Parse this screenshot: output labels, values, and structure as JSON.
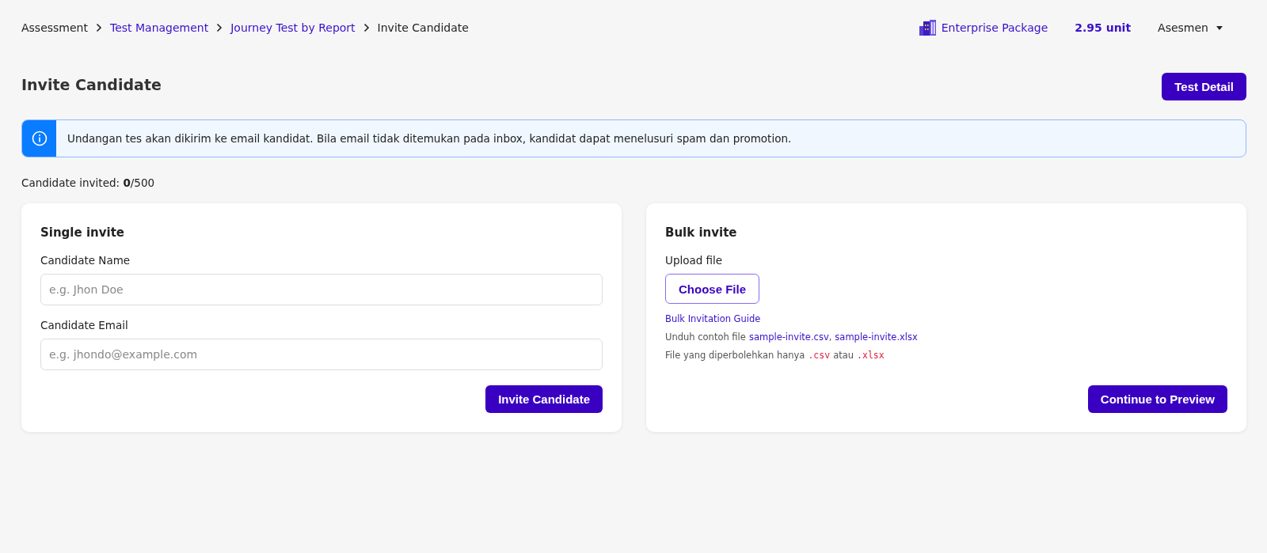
{
  "breadcrumb": [
    {
      "label": "Assessment",
      "link": false
    },
    {
      "label": "Test Management",
      "link": true
    },
    {
      "label": "Journey Test by Report",
      "link": true
    },
    {
      "label": "Invite Candidate",
      "link": false
    }
  ],
  "header": {
    "package": "Enterprise Package",
    "units": "2.95 unit",
    "user": "Asesmen"
  },
  "title": "Invite Candidate",
  "test_detail_button": "Test Detail",
  "info": "Undangan tes akan dikirim ke email kandidat. Bila email tidak ditemukan pada inbox, kandidat dapat menelusuri spam dan promotion.",
  "invited": {
    "label": "Candidate invited: ",
    "count": "0",
    "total": "/500"
  },
  "single": {
    "title": "Single invite",
    "fields": [
      {
        "label": "Candidate Name",
        "placeholder": "e.g. Jhon Doe"
      },
      {
        "label": "Candidate Email",
        "placeholder": "e.g. jhondo@example.com"
      }
    ],
    "button": "Invite Candidate"
  },
  "bulk": {
    "title": "Bulk invite",
    "upload_label": "Upload file",
    "choose_button": "Choose File",
    "guide_link": "Bulk Invitation Guide",
    "download": {
      "prefix": "Unduh contoh file",
      "files": [
        "sample-invite.csv",
        "sample-invite.xlsx"
      ],
      "separator": ","
    },
    "allowed": {
      "prefix": "File yang diperbolehkan hanya",
      "formats": [
        ".csv",
        ".xlsx"
      ],
      "joiner": "atau"
    },
    "button": "Continue to Preview"
  }
}
